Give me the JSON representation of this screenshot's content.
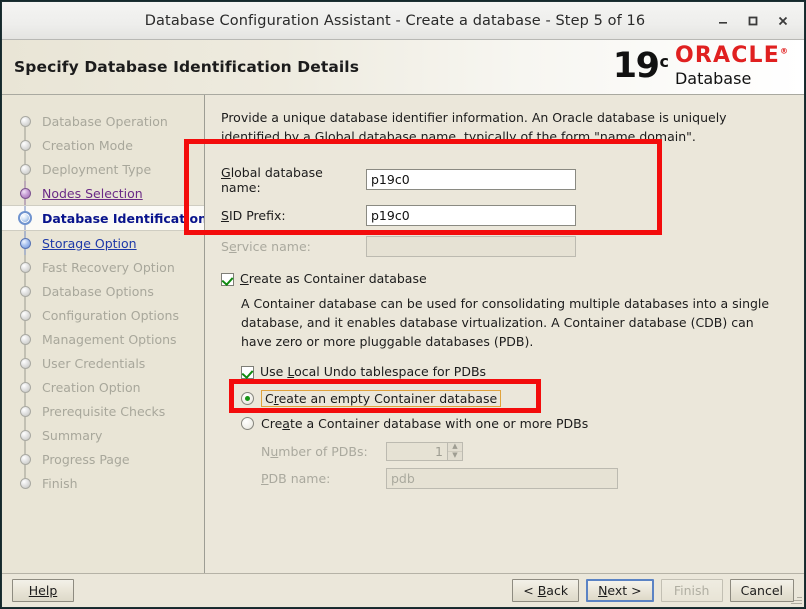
{
  "window": {
    "title": "Database Configuration Assistant - Create a database - Step 5 of 16",
    "minimize_icon": "minimize-icon",
    "maximize_icon": "maximize-icon",
    "close_icon": "close-icon"
  },
  "header": {
    "title": "Specify Database Identification Details",
    "brand": {
      "version": "19",
      "version_sup": "c",
      "oracle": "ORACLE",
      "oracle_sup": "®",
      "product": "Database",
      "oracle_color": "#e02020"
    }
  },
  "sidebar": {
    "items": [
      {
        "label": "Database Operation",
        "state": "disabled"
      },
      {
        "label": "Creation Mode",
        "state": "disabled"
      },
      {
        "label": "Deployment Type",
        "state": "disabled"
      },
      {
        "label": "Nodes Selection",
        "state": "done"
      },
      {
        "label": "Database Identification",
        "state": "current"
      },
      {
        "label": "Storage Option",
        "state": "next"
      },
      {
        "label": "Fast Recovery Option",
        "state": "disabled"
      },
      {
        "label": "Database Options",
        "state": "disabled"
      },
      {
        "label": "Configuration Options",
        "state": "disabled"
      },
      {
        "label": "Management Options",
        "state": "disabled"
      },
      {
        "label": "User Credentials",
        "state": "disabled"
      },
      {
        "label": "Creation Option",
        "state": "disabled"
      },
      {
        "label": "Prerequisite Checks",
        "state": "disabled"
      },
      {
        "label": "Summary",
        "state": "disabled"
      },
      {
        "label": "Progress Page",
        "state": "disabled"
      },
      {
        "label": "Finish",
        "state": "disabled"
      }
    ]
  },
  "main": {
    "intro": "Provide a unique database identifier information. An Oracle database is uniquely identified by a Global database name, typically of the form \"name.domain\".",
    "fields": {
      "global_db_name_label": "Global database name:",
      "global_db_name_value": "p19c0",
      "sid_prefix_label": "SID Prefix:",
      "sid_prefix_value": "p19c0",
      "service_name_label": "Service name:",
      "service_name_value": ""
    },
    "container": {
      "checkbox_label": "Create as Container database",
      "checkbox_checked": true,
      "description": "A Container database can be used for consolidating multiple databases into a single database, and it enables database virtualization. A Container database (CDB) can have zero or more pluggable databases (PDB).",
      "undo_checkbox_label": "Use Local Undo tablespace for PDBs",
      "undo_checkbox_checked": true,
      "radio_empty_label": "Create an empty Container database",
      "radio_empty_selected": true,
      "radio_pdbs_label": "Create a Container database with one or more PDBs",
      "radio_pdbs_selected": false,
      "num_pdbs_label": "Number of PDBs:",
      "num_pdbs_value": "1",
      "pdb_name_label": "PDB name:",
      "pdb_name_value": "pdb"
    }
  },
  "footer": {
    "help": "Help",
    "back": "< Back",
    "next": "Next >",
    "finish": "Finish",
    "cancel": "Cancel"
  },
  "annotations": {
    "accent_color": "#f30c0c",
    "focus_color": "#e0a33c"
  }
}
